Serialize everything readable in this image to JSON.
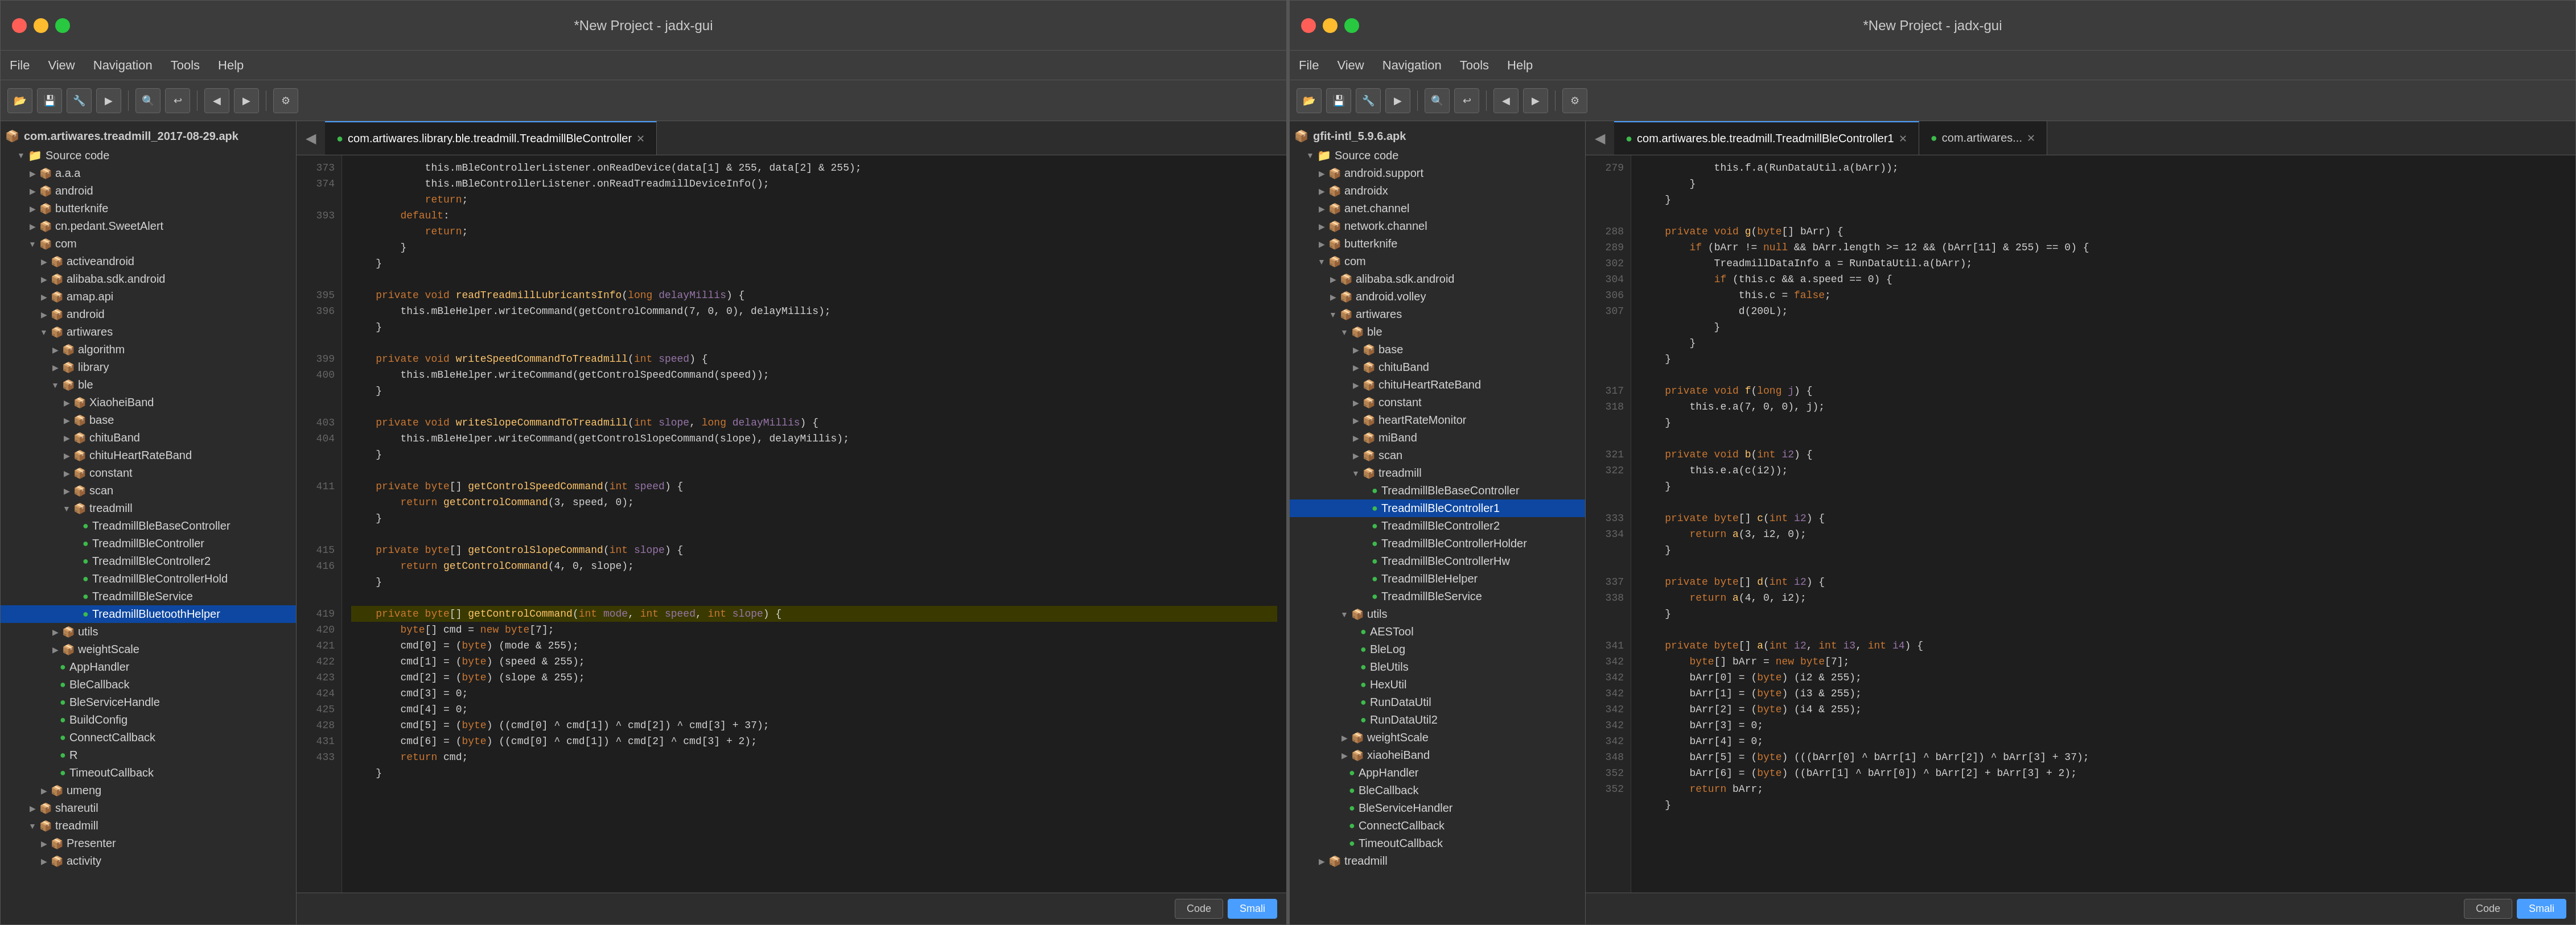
{
  "windows": [
    {
      "id": "left-window",
      "title": "*New Project - jadx-gui",
      "menu": [
        "File",
        "View",
        "Navigation",
        "Tools",
        "Help"
      ],
      "apk": "com.artiwares.treadmill_2017-08-29.apk",
      "sidebar_items": [
        {
          "label": "Source code",
          "indent": 1,
          "type": "folder",
          "expanded": true
        },
        {
          "label": "a.a.a",
          "indent": 2,
          "type": "pkg"
        },
        {
          "label": "android",
          "indent": 2,
          "type": "pkg"
        },
        {
          "label": "butterknife",
          "indent": 2,
          "type": "pkg"
        },
        {
          "label": "cn.pedant.SweetAlert",
          "indent": 2,
          "type": "pkg"
        },
        {
          "label": "com",
          "indent": 2,
          "type": "pkg",
          "expanded": true
        },
        {
          "label": "activeandroid",
          "indent": 3,
          "type": "pkg"
        },
        {
          "label": "alibaba.sdk.android",
          "indent": 3,
          "type": "pkg"
        },
        {
          "label": "amap.api",
          "indent": 3,
          "type": "pkg"
        },
        {
          "label": "android",
          "indent": 3,
          "type": "pkg"
        },
        {
          "label": "artiwares",
          "indent": 3,
          "type": "pkg",
          "expanded": true
        },
        {
          "label": "algorithm",
          "indent": 4,
          "type": "pkg"
        },
        {
          "label": "library",
          "indent": 4,
          "type": "pkg"
        },
        {
          "label": "ble",
          "indent": 4,
          "type": "pkg",
          "expanded": true
        },
        {
          "label": "XiaoheiBand",
          "indent": 5,
          "type": "pkg"
        },
        {
          "label": "base",
          "indent": 5,
          "type": "pkg"
        },
        {
          "label": "chituBand",
          "indent": 5,
          "type": "pkg"
        },
        {
          "label": "chituHeartRateBand",
          "indent": 5,
          "type": "pkg"
        },
        {
          "label": "constant",
          "indent": 5,
          "type": "pkg"
        },
        {
          "label": "scan",
          "indent": 5,
          "type": "pkg"
        },
        {
          "label": "treadmill",
          "indent": 5,
          "type": "pkg",
          "expanded": true
        },
        {
          "label": "TreadmillBleBaseController",
          "indent": 6,
          "type": "class"
        },
        {
          "label": "TreadmillBleController",
          "indent": 6,
          "type": "class"
        },
        {
          "label": "TreadmillBleController2",
          "indent": 6,
          "type": "class"
        },
        {
          "label": "TreadmillBleControllerHold",
          "indent": 6,
          "type": "class"
        },
        {
          "label": "TreadmillBleService",
          "indent": 6,
          "type": "class"
        },
        {
          "label": "TreadmillBluetoothHelper",
          "indent": 6,
          "type": "class",
          "selected": true
        },
        {
          "label": "utils",
          "indent": 4,
          "type": "pkg"
        },
        {
          "label": "weightScale",
          "indent": 4,
          "type": "pkg"
        },
        {
          "label": "AppHandler",
          "indent": 4,
          "type": "class"
        },
        {
          "label": "BleCallback",
          "indent": 4,
          "type": "class"
        },
        {
          "label": "BleServiceHandle",
          "indent": 4,
          "type": "class"
        },
        {
          "label": "BuildConfig",
          "indent": 4,
          "type": "class"
        },
        {
          "label": "ConnectCallback",
          "indent": 4,
          "type": "class"
        },
        {
          "label": "R",
          "indent": 4,
          "type": "class"
        },
        {
          "label": "TimeoutCallback",
          "indent": 4,
          "type": "class"
        },
        {
          "label": "umeng",
          "indent": 3,
          "type": "pkg"
        },
        {
          "label": "shareutil",
          "indent": 2,
          "type": "pkg"
        },
        {
          "label": "treadmill",
          "indent": 2,
          "type": "pkg",
          "expanded": true
        },
        {
          "label": "Presenter",
          "indent": 3,
          "type": "pkg"
        },
        {
          "label": "activity",
          "indent": 3,
          "type": "pkg"
        }
      ],
      "tab_label": "com.artiwares.library.ble.treadmill.TreadmillBleController",
      "code_lines": [
        {
          "num": 373,
          "text": "            this.mBleControllerListener.onReadDevice(data[1] & 255, data[2] & 255);",
          "highlight": false
        },
        {
          "num": 374,
          "text": "            this.mBleControllerListener.onReadTreadmillDeviceInfo();",
          "highlight": false
        },
        {
          "num": "",
          "text": "            return;",
          "highlight": false
        },
        {
          "num": "393",
          "text": "        default:",
          "highlight": false
        },
        {
          "num": "",
          "text": "            return;",
          "highlight": false
        },
        {
          "num": "",
          "text": "        }",
          "highlight": false
        },
        {
          "num": "",
          "text": "    }",
          "highlight": false
        },
        {
          "num": "",
          "text": "",
          "highlight": false
        },
        {
          "num": "395",
          "text": "    private void readTreadmillLubricantsInfo(long delayMillis) {",
          "highlight": false
        },
        {
          "num": "396",
          "text": "        this.mBleHelper.writeCommand(getControlCommand(7, 0, 0), delayMillis);",
          "highlight": false
        },
        {
          "num": "",
          "text": "    }",
          "highlight": false
        },
        {
          "num": "",
          "text": "",
          "highlight": false
        },
        {
          "num": "399",
          "text": "    private void writeSpeedCommandToTreadmill(int speed) {",
          "highlight": false
        },
        {
          "num": "400",
          "text": "        this.mBleHelper.writeCommand(getControlSpeedCommand(speed));",
          "highlight": false
        },
        {
          "num": "",
          "text": "    }",
          "highlight": false
        },
        {
          "num": "",
          "text": "",
          "highlight": false
        },
        {
          "num": "403",
          "text": "    private void writeSlopeCommandToTreadmill(int slope, long delayMillis) {",
          "highlight": false
        },
        {
          "num": "404",
          "text": "        this.mBleHelper.writeCommand(getControlSlopeCommand(slope), delayMillis);",
          "highlight": false
        },
        {
          "num": "",
          "text": "    }",
          "highlight": false
        },
        {
          "num": "",
          "text": "",
          "highlight": false
        },
        {
          "num": "411",
          "text": "    private byte[] getControlSpeedCommand(int speed) {",
          "highlight": false
        },
        {
          "num": "",
          "text": "        return getControlCommand(3, speed, 0);",
          "highlight": false
        },
        {
          "num": "",
          "text": "    }",
          "highlight": false
        },
        {
          "num": "",
          "text": "",
          "highlight": false
        },
        {
          "num": "415",
          "text": "    private byte[] getControlSlopeCommand(int slope) {",
          "highlight": false
        },
        {
          "num": "416",
          "text": "        return getControlCommand(4, 0, slope);",
          "highlight": false
        },
        {
          "num": "",
          "text": "    }",
          "highlight": false
        },
        {
          "num": "",
          "text": "",
          "highlight": false
        },
        {
          "num": "419",
          "text": "    private byte[] getControlCommand(int mode, int speed, int slope) {",
          "highlight": true
        },
        {
          "num": "420",
          "text": "        byte[] cmd = new byte[7];",
          "highlight": false
        },
        {
          "num": "421",
          "text": "        cmd[0] = (byte) (mode & 255);",
          "highlight": false
        },
        {
          "num": "422",
          "text": "        cmd[1] = (byte) (speed & 255);",
          "highlight": false
        },
        {
          "num": "423",
          "text": "        cmd[2] = (byte) (slope & 255);",
          "highlight": false
        },
        {
          "num": "424",
          "text": "        cmd[3] = 0;",
          "highlight": false
        },
        {
          "num": "425",
          "text": "        cmd[4] = 0;",
          "highlight": false
        },
        {
          "num": "428",
          "text": "        cmd[5] = (byte) ((cmd[0] ^ cmd[1]) ^ cmd[2]) ^ cmd[3] + 37);",
          "highlight": false
        },
        {
          "num": "431",
          "text": "        cmd[6] = (byte) ((cmd[0] ^ cmd[1]) ^ cmd[2] ^ cmd[3] + 2);",
          "highlight": false
        },
        {
          "num": "433",
          "text": "        return cmd;",
          "highlight": false
        },
        {
          "num": "",
          "text": "    }",
          "highlight": false
        }
      ]
    },
    {
      "id": "right-window",
      "title": "*New Project - jadx-gui",
      "menu": [
        "File",
        "View",
        "Navigation",
        "Tools",
        "Help"
      ],
      "apk": "gfit-intl_5.9.6.apk",
      "sidebar_items": [
        {
          "label": "Source code",
          "indent": 1,
          "type": "folder",
          "expanded": true
        },
        {
          "label": "android.support",
          "indent": 2,
          "type": "pkg"
        },
        {
          "label": "androidx",
          "indent": 2,
          "type": "pkg"
        },
        {
          "label": "anet.channel",
          "indent": 2,
          "type": "pkg"
        },
        {
          "label": "network.channel",
          "indent": 2,
          "type": "pkg"
        },
        {
          "label": "butterknife",
          "indent": 2,
          "type": "pkg"
        },
        {
          "label": "com",
          "indent": 2,
          "type": "pkg",
          "expanded": true
        },
        {
          "label": "alibaba.sdk.android",
          "indent": 3,
          "type": "pkg"
        },
        {
          "label": "android.volley",
          "indent": 3,
          "type": "pkg"
        },
        {
          "label": "artiwares",
          "indent": 3,
          "type": "pkg",
          "expanded": true
        },
        {
          "label": "ble",
          "indent": 4,
          "type": "pkg",
          "expanded": true
        },
        {
          "label": "base",
          "indent": 5,
          "type": "pkg"
        },
        {
          "label": "chituBand",
          "indent": 5,
          "type": "pkg"
        },
        {
          "label": "chituHeartRateBand",
          "indent": 5,
          "type": "pkg"
        },
        {
          "label": "constant",
          "indent": 5,
          "type": "pkg"
        },
        {
          "label": "heartRateMonitor",
          "indent": 5,
          "type": "pkg"
        },
        {
          "label": "miBand",
          "indent": 5,
          "type": "pkg"
        },
        {
          "label": "scan",
          "indent": 5,
          "type": "pkg"
        },
        {
          "label": "treadmill",
          "indent": 5,
          "type": "pkg",
          "expanded": true
        },
        {
          "label": "TreadmillBleBaseController",
          "indent": 6,
          "type": "class"
        },
        {
          "label": "TreadmillBleController1",
          "indent": 6,
          "type": "class",
          "selected": true
        },
        {
          "label": "TreadmillBleController2",
          "indent": 6,
          "type": "class"
        },
        {
          "label": "TreadmillBleControllerHolder",
          "indent": 6,
          "type": "class"
        },
        {
          "label": "TreadmillBleControllerHw",
          "indent": 6,
          "type": "class"
        },
        {
          "label": "TreadmillBleHelper",
          "indent": 6,
          "type": "class"
        },
        {
          "label": "TreadmillBleService",
          "indent": 6,
          "type": "class"
        },
        {
          "label": "utils",
          "indent": 4,
          "type": "pkg",
          "expanded": true
        },
        {
          "label": "AESTool",
          "indent": 5,
          "type": "class"
        },
        {
          "label": "BleLog",
          "indent": 5,
          "type": "class"
        },
        {
          "label": "BleUtils",
          "indent": 5,
          "type": "class"
        },
        {
          "label": "HexUtil",
          "indent": 5,
          "type": "class"
        },
        {
          "label": "RunDataUtil",
          "indent": 5,
          "type": "class"
        },
        {
          "label": "RunDataUtil2",
          "indent": 5,
          "type": "class"
        },
        {
          "label": "weightScale",
          "indent": 4,
          "type": "pkg"
        },
        {
          "label": "xiaoheiBand",
          "indent": 4,
          "type": "pkg"
        },
        {
          "label": "AppHandler",
          "indent": 4,
          "type": "class"
        },
        {
          "label": "BleCallback",
          "indent": 4,
          "type": "class"
        },
        {
          "label": "BleServiceHandler",
          "indent": 4,
          "type": "class"
        },
        {
          "label": "ConnectCallback",
          "indent": 4,
          "type": "class"
        },
        {
          "label": "TimeoutCallback",
          "indent": 4,
          "type": "class"
        },
        {
          "label": "treadmill",
          "indent": 2,
          "type": "pkg"
        }
      ],
      "tab_label": "com.artiwares.ble.treadmill.TreadmillBleController1",
      "tab_label2": "com.artiwares...",
      "code_lines": [
        {
          "num": "279",
          "text": "            this.f.a(RunDataUtil.a(bArr));",
          "highlight": false
        },
        {
          "num": "",
          "text": "        }",
          "highlight": false
        },
        {
          "num": "",
          "text": "    }",
          "highlight": false
        },
        {
          "num": "",
          "text": "",
          "highlight": false
        },
        {
          "num": "288",
          "text": "    private void g(byte[] bArr) {",
          "highlight": false
        },
        {
          "num": "289",
          "text": "        if (bArr != null && bArr.length >= 12 && (bArr[11] & 255) == 0) {",
          "highlight": false
        },
        {
          "num": "302",
          "text": "            TreadmillDataInfo a = RunDataUtil.a(bArr);",
          "highlight": false
        },
        {
          "num": "304",
          "text": "            if (this.c && a.speed == 0) {",
          "highlight": false
        },
        {
          "num": "306",
          "text": "                this.c = false;",
          "highlight": false
        },
        {
          "num": "307",
          "text": "                d(200L);",
          "highlight": false
        },
        {
          "num": "",
          "text": "            }",
          "highlight": false
        },
        {
          "num": "",
          "text": "        }",
          "highlight": false
        },
        {
          "num": "",
          "text": "    }",
          "highlight": false
        },
        {
          "num": "",
          "text": "",
          "highlight": false
        },
        {
          "num": "317",
          "text": "    private void f(long j) {",
          "highlight": false
        },
        {
          "num": "318",
          "text": "        this.e.a(7, 0, 0), j);",
          "highlight": false
        },
        {
          "num": "",
          "text": "    }",
          "highlight": false
        },
        {
          "num": "",
          "text": "",
          "highlight": false
        },
        {
          "num": "321",
          "text": "    private void b(int i2) {",
          "highlight": false
        },
        {
          "num": "322",
          "text": "        this.e.a(c(i2));",
          "highlight": false
        },
        {
          "num": "",
          "text": "    }",
          "highlight": false
        },
        {
          "num": "",
          "text": "",
          "highlight": false
        },
        {
          "num": "333",
          "text": "    private byte[] c(int i2) {",
          "highlight": false
        },
        {
          "num": "334",
          "text": "        return a(3, i2, 0);",
          "highlight": false
        },
        {
          "num": "",
          "text": "    }",
          "highlight": false
        },
        {
          "num": "",
          "text": "",
          "highlight": false
        },
        {
          "num": "337",
          "text": "    private byte[] d(int i2) {",
          "highlight": false
        },
        {
          "num": "338",
          "text": "        return a(4, 0, i2);",
          "highlight": false
        },
        {
          "num": "",
          "text": "    }",
          "highlight": false
        },
        {
          "num": "",
          "text": "",
          "highlight": false
        },
        {
          "num": "341",
          "text": "    private byte[] a(int i2, int i3, int i4) {",
          "highlight": false
        },
        {
          "num": "342",
          "text": "        byte[] bArr = new byte[7];",
          "highlight": false
        },
        {
          "num": "342",
          "text": "        bArr[0] = (byte) (i2 & 255);",
          "highlight": false
        },
        {
          "num": "342",
          "text": "        bArr[1] = (byte) (i3 & 255);",
          "highlight": false
        },
        {
          "num": "342",
          "text": "        bArr[2] = (byte) (i4 & 255);",
          "highlight": false
        },
        {
          "num": "342",
          "text": "        bArr[3] = 0;",
          "highlight": false
        },
        {
          "num": "342",
          "text": "        bArr[4] = 0;",
          "highlight": false
        },
        {
          "num": "348",
          "text": "        bArr[5] = (byte) (((bArr[0] ^ bArr[1] ^ bArr[2]) ^ bArr[3] + 37);",
          "highlight": false
        },
        {
          "num": "352",
          "text": "        bArr[6] = (byte) ((bArr[1] ^ bArr[0]) ^ bArr[2] + bArr[3] + 2);",
          "highlight": false
        },
        {
          "num": "352",
          "text": "        return bArr;",
          "highlight": false
        },
        {
          "num": "",
          "text": "    }",
          "highlight": false
        }
      ]
    }
  ]
}
